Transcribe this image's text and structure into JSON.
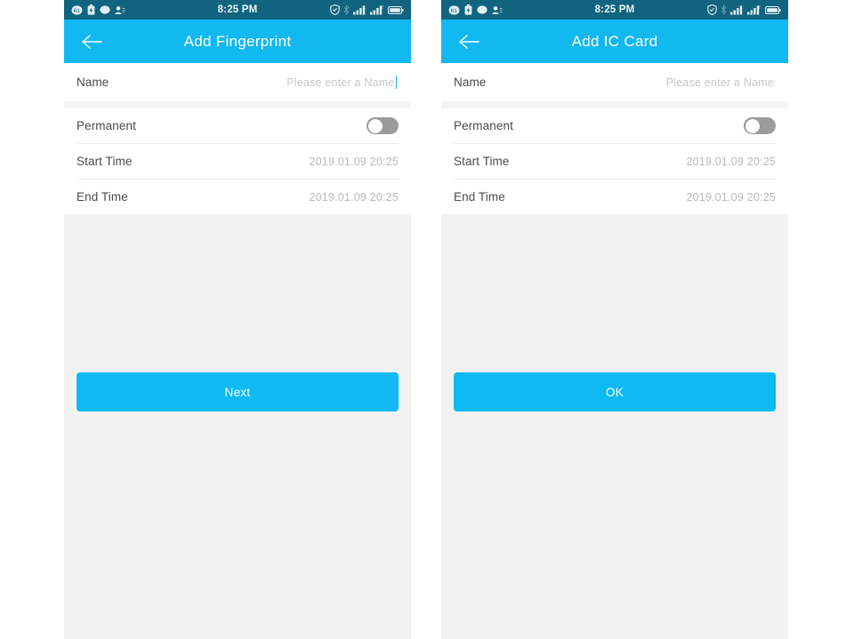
{
  "screens": [
    {
      "id": "add-fingerprint",
      "statusbar": {
        "time": "8:25 PM",
        "left_icons": [
          "sim-badge-icon",
          "battery-saver-icon",
          "message-bubble-icon",
          "contacts-icon"
        ],
        "right_icons": [
          "shield-icon",
          "bluetooth-icon",
          "signal-bars-icon",
          "signal-bars-alt-icon",
          "battery-icon"
        ]
      },
      "navbar": {
        "back_icon": "back-arrow-icon",
        "title": "Add Fingerprint"
      },
      "form": {
        "name": {
          "label": "Name",
          "placeholder": "Please enter a Name",
          "value": "",
          "focused": true
        },
        "permanent": {
          "label": "Permanent",
          "toggle_state": "off"
        },
        "start_time": {
          "label": "Start Time",
          "value": "2019.01.09 20:25"
        },
        "end_time": {
          "label": "End Time",
          "value": "2019.01.09 20:25"
        }
      },
      "action": {
        "label": "Next"
      }
    },
    {
      "id": "add-ic-card",
      "statusbar": {
        "time": "8:25 PM",
        "left_icons": [
          "sim-badge-icon",
          "battery-saver-icon",
          "message-bubble-icon",
          "contacts-icon"
        ],
        "right_icons": [
          "shield-icon",
          "bluetooth-icon",
          "signal-bars-icon",
          "signal-bars-alt-icon",
          "battery-icon"
        ]
      },
      "navbar": {
        "back_icon": "back-arrow-icon",
        "title": "Add IC Card"
      },
      "form": {
        "name": {
          "label": "Name",
          "placeholder": "Please enter a Name",
          "value": "",
          "focused": false
        },
        "permanent": {
          "label": "Permanent",
          "toggle_state": "off"
        },
        "start_time": {
          "label": "Start Time",
          "value": "2019.01.09 20:25"
        },
        "end_time": {
          "label": "End Time",
          "value": "2019.01.09 20:25"
        }
      },
      "action": {
        "label": "OK"
      }
    }
  ],
  "colors": {
    "statusbar_bg": "#10647f",
    "navbar_bg": "#12b8f0",
    "accent": "#0fb9f2",
    "page_bg": "#ffffff",
    "panel_bg": "#f2f2f2",
    "row_bg": "#ffffff",
    "toggle_off": "#9b9b9b",
    "label_text": "#4a4a4a",
    "value_text": "#b9b9b9"
  }
}
